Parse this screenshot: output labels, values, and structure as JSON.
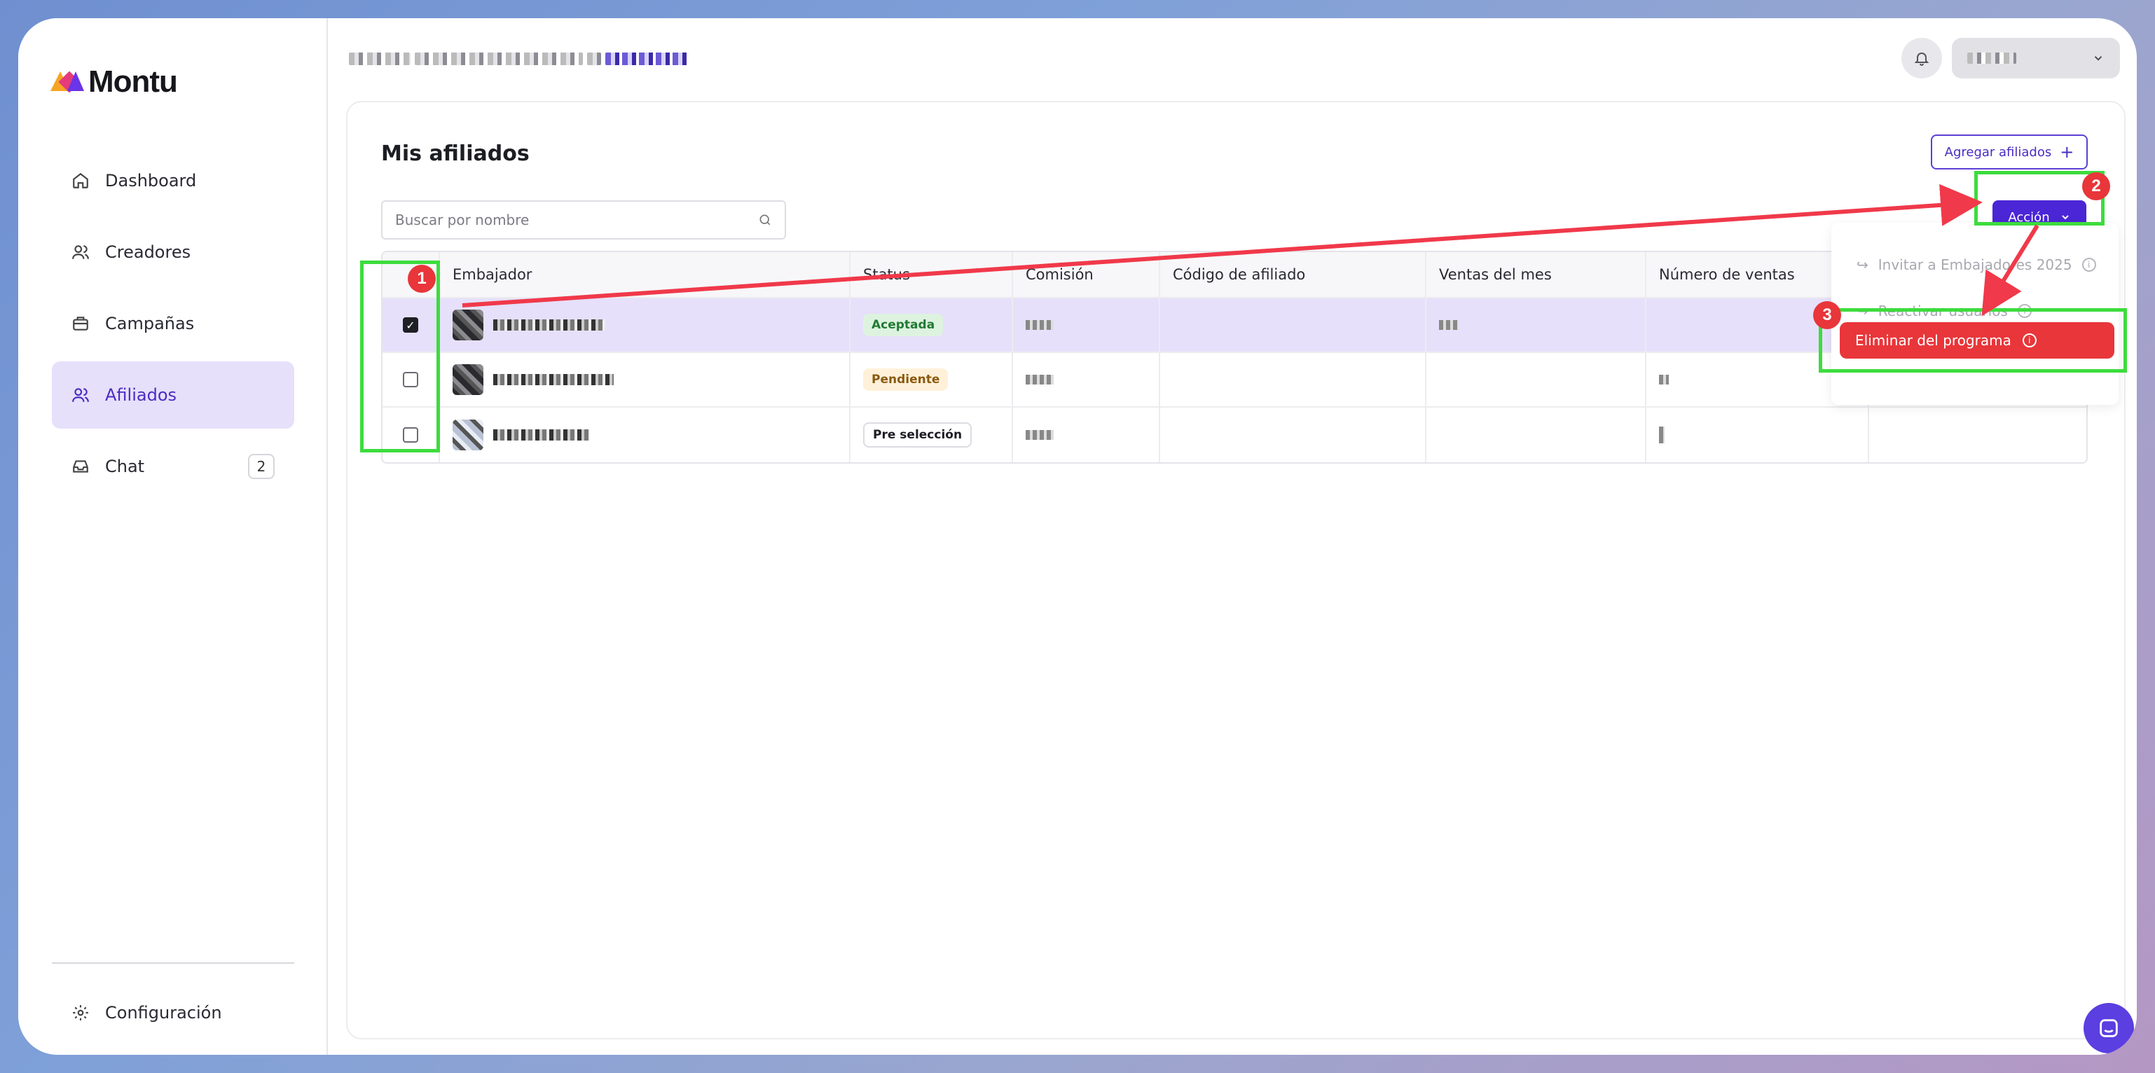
{
  "app": {
    "logo_text": "Montu"
  },
  "sidebar": {
    "items": [
      {
        "label": "Dashboard",
        "icon": "home-icon"
      },
      {
        "label": "Creadores",
        "icon": "users-icon"
      },
      {
        "label": "Campañas",
        "icon": "briefcase-icon"
      },
      {
        "label": "Afiliados",
        "icon": "affiliates-icon",
        "active": true
      },
      {
        "label": "Chat",
        "icon": "inbox-icon",
        "badge": "2"
      }
    ],
    "settings_label": "Configuración"
  },
  "main": {
    "title": "Mis afiliados",
    "add_button": "Agregar afiliados",
    "search_placeholder": "Buscar por nombre",
    "action_button": "Acción",
    "table": {
      "headers": [
        "Embajador",
        "Status",
        "Comisión",
        "Código de afiliado",
        "Ventas del mes",
        "Número de ventas"
      ],
      "rows": [
        {
          "checked": true,
          "status": "Aceptada",
          "status_type": "accepted"
        },
        {
          "checked": false,
          "status": "Pendiente",
          "status_type": "pending"
        },
        {
          "checked": false,
          "status": "Pre selección",
          "status_type": "preselect"
        }
      ]
    },
    "action_menu": {
      "items": [
        "Invitar a Embajadores 2025",
        "Reactivar usuarios"
      ],
      "danger_item": "Eliminar del programa"
    }
  },
  "annotations": {
    "steps": [
      "1",
      "2",
      "3"
    ]
  },
  "colors": {
    "accent": "#4b26d6",
    "danger": "#e8363a",
    "highlight": "#3ddc3d"
  }
}
